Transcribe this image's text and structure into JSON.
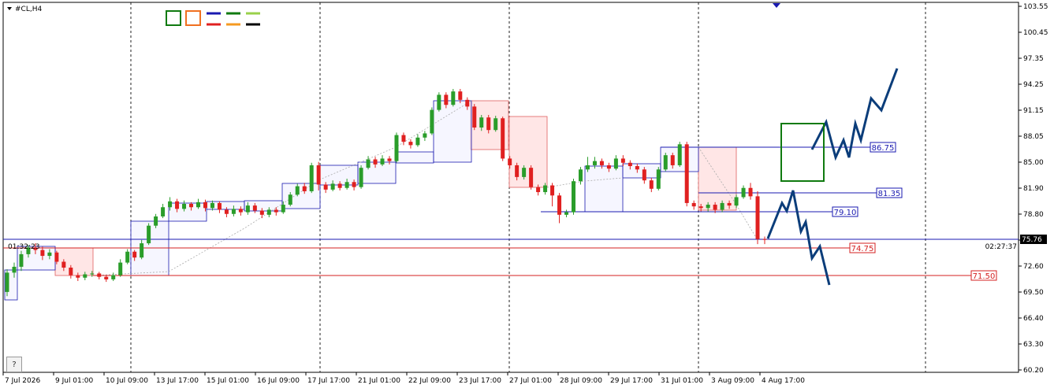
{
  "symbol_label": "#CL,H4",
  "time_left": "01:32:23",
  "time_right": "02:27:37",
  "help_label": "?",
  "legend_icons": [
    "square-green-icon",
    "square-orange-icon",
    "line-blue-icon",
    "line-green-icon",
    "line-lightgreen-icon",
    "line-red-icon",
    "line-orange-icon",
    "line-black-icon"
  ],
  "colors": {
    "bull": "#2a9d2a",
    "bear": "#e02020",
    "level_blue": "#1a1ab0",
    "level_red": "#d42020",
    "forecast": "#0b3d7a",
    "current_price_bg": "#000000",
    "box_green": "#0f7a0f"
  },
  "price_axis": [
    "103.55",
    "100.45",
    "97.35",
    "94.25",
    "91.15",
    "88.05",
    "85.00",
    "81.90",
    "78.80",
    "75.70",
    "72.60",
    "69.50",
    "66.40",
    "63.30",
    "60.20"
  ],
  "time_axis": [
    "7 Jul 2026",
    "9 Jul 01:00",
    "10 Jul 09:00",
    "13 Jul 17:00",
    "15 Jul 01:00",
    "16 Jul 09:00",
    "17 Jul 17:00",
    "21 Jul 01:00",
    "22 Jul 09:00",
    "23 Jul 17:00",
    "27 Jul 01:00",
    "28 Jul 09:00",
    "29 Jul 17:00",
    "31 Jul 01:00",
    "3 Aug 09:00",
    "4 Aug 17:00"
  ],
  "levels": {
    "l8675": "86.75",
    "l8135": "81.35",
    "l7910": "79.10",
    "l7475": "74.75",
    "l7150": "71.50",
    "current": "75.76"
  },
  "chart_data": {
    "type": "candlestick",
    "symbol": "#CL",
    "timeframe": "H4",
    "ylim": [
      60.2,
      103.55
    ],
    "current_price": 75.76,
    "levels": [
      86.75,
      81.35,
      79.1,
      74.75,
      71.5
    ],
    "candles": [
      [
        69.5,
        71.8,
        69.0,
        72.2
      ],
      [
        71.8,
        72.5,
        71.2,
        73.0
      ],
      [
        72.5,
        74.0,
        72.0,
        74.4
      ],
      [
        74.0,
        74.8,
        73.6,
        75.1
      ],
      [
        74.8,
        74.5,
        74.0,
        75.3
      ],
      [
        74.5,
        73.8,
        73.3,
        74.9
      ],
      [
        73.8,
        74.2,
        73.4,
        74.6
      ],
      [
        74.2,
        73.1,
        72.8,
        74.4
      ],
      [
        73.1,
        72.4,
        72.0,
        73.4
      ],
      [
        72.4,
        71.5,
        71.1,
        72.7
      ],
      [
        71.5,
        71.2,
        70.8,
        71.8
      ],
      [
        71.2,
        71.6,
        70.9,
        71.9
      ],
      [
        71.6,
        71.7,
        71.3,
        72.0
      ],
      [
        71.7,
        71.3,
        71.0,
        71.9
      ],
      [
        71.3,
        71.0,
        70.7,
        71.5
      ],
      [
        71.0,
        71.5,
        70.8,
        71.8
      ],
      [
        71.5,
        73.0,
        71.3,
        73.4
      ],
      [
        73.0,
        74.3,
        72.8,
        74.6
      ],
      [
        74.3,
        73.6,
        73.2,
        74.5
      ],
      [
        73.6,
        75.3,
        73.4,
        75.7
      ],
      [
        75.3,
        77.4,
        75.1,
        77.7
      ],
      [
        77.4,
        78.5,
        77.1,
        78.8
      ],
      [
        78.5,
        79.6,
        78.3,
        80.0
      ],
      [
        79.6,
        80.3,
        79.2,
        80.8
      ],
      [
        80.3,
        79.4,
        79.0,
        80.6
      ],
      [
        79.4,
        80.0,
        79.1,
        80.4
      ],
      [
        80.0,
        79.6,
        79.2,
        80.2
      ],
      [
        79.6,
        80.2,
        79.4,
        80.6
      ],
      [
        80.2,
        79.5,
        79.1,
        80.5
      ],
      [
        79.5,
        80.1,
        79.2,
        80.4
      ],
      [
        80.1,
        79.3,
        78.9,
        80.3
      ],
      [
        79.3,
        78.8,
        78.4,
        79.6
      ],
      [
        78.8,
        79.4,
        78.5,
        79.8
      ],
      [
        79.4,
        79.0,
        78.6,
        79.7
      ],
      [
        79.0,
        79.8,
        78.7,
        80.2
      ],
      [
        79.8,
        79.2,
        78.9,
        80.1
      ],
      [
        79.2,
        78.7,
        78.3,
        79.5
      ],
      [
        78.7,
        79.3,
        78.4,
        79.6
      ],
      [
        79.3,
        79.0,
        78.6,
        79.6
      ],
      [
        79.0,
        79.9,
        78.8,
        80.3
      ],
      [
        79.9,
        81.1,
        79.7,
        81.4
      ],
      [
        81.1,
        82.1,
        80.9,
        82.4
      ],
      [
        82.1,
        81.5,
        81.2,
        82.5
      ],
      [
        81.5,
        84.6,
        81.3,
        84.9
      ],
      [
        84.6,
        82.3,
        81.6,
        85.0
      ],
      [
        82.3,
        81.7,
        81.3,
        82.6
      ],
      [
        81.7,
        82.4,
        81.5,
        82.8
      ],
      [
        82.4,
        81.9,
        81.6,
        82.7
      ],
      [
        81.9,
        82.6,
        81.7,
        83.0
      ],
      [
        82.6,
        82.0,
        81.6,
        82.9
      ],
      [
        82.0,
        84.3,
        81.8,
        84.6
      ],
      [
        84.3,
        85.3,
        84.1,
        85.7
      ],
      [
        85.3,
        84.7,
        84.3,
        85.6
      ],
      [
        84.7,
        85.4,
        84.5,
        85.8
      ],
      [
        85.4,
        85.1,
        84.7,
        85.7
      ],
      [
        85.1,
        88.2,
        84.9,
        88.5
      ],
      [
        88.2,
        87.4,
        87.0,
        88.5
      ],
      [
        87.4,
        87.0,
        86.6,
        87.7
      ],
      [
        87.0,
        87.9,
        86.8,
        88.3
      ],
      [
        87.9,
        88.4,
        87.5,
        88.7
      ],
      [
        88.4,
        91.2,
        88.2,
        91.5
      ],
      [
        91.2,
        93.0,
        91.0,
        93.3
      ],
      [
        93.0,
        91.8,
        91.4,
        93.3
      ],
      [
        91.8,
        93.4,
        91.6,
        93.7
      ],
      [
        93.4,
        92.4,
        92.0,
        93.7
      ],
      [
        92.4,
        91.6,
        91.2,
        92.7
      ],
      [
        91.6,
        89.1,
        88.8,
        91.9
      ],
      [
        89.1,
        90.3,
        88.7,
        90.6
      ],
      [
        90.3,
        88.8,
        88.4,
        90.6
      ],
      [
        88.8,
        90.2,
        88.6,
        90.5
      ],
      [
        90.2,
        85.4,
        85.1,
        90.4
      ],
      [
        85.4,
        84.6,
        84.2,
        85.7
      ],
      [
        84.6,
        83.2,
        82.8,
        84.9
      ],
      [
        83.2,
        84.3,
        82.9,
        84.6
      ],
      [
        84.3,
        82.0,
        81.7,
        84.6
      ],
      [
        82.0,
        81.4,
        81.0,
        82.3
      ],
      [
        81.4,
        82.2,
        81.1,
        82.5
      ],
      [
        82.2,
        81.0,
        79.7,
        82.5
      ],
      [
        81.0,
        78.7,
        77.7,
        81.3
      ],
      [
        78.7,
        79.0,
        78.4,
        79.3
      ],
      [
        79.0,
        82.7,
        78.7,
        83.0
      ],
      [
        82.7,
        84.1,
        82.3,
        84.4
      ],
      [
        84.1,
        84.6,
        83.8,
        85.6
      ],
      [
        84.6,
        85.1,
        84.2,
        85.6
      ],
      [
        85.1,
        84.6,
        84.2,
        85.4
      ],
      [
        84.6,
        84.2,
        83.8,
        84.9
      ],
      [
        84.2,
        85.4,
        84.0,
        85.8
      ],
      [
        85.4,
        84.9,
        84.5,
        85.8
      ],
      [
        84.9,
        84.5,
        84.1,
        85.2
      ],
      [
        84.5,
        84.1,
        83.7,
        84.8
      ],
      [
        84.1,
        82.8,
        82.4,
        84.4
      ],
      [
        82.8,
        81.8,
        81.4,
        83.1
      ],
      [
        81.8,
        84.1,
        81.6,
        84.4
      ],
      [
        84.1,
        85.8,
        83.9,
        86.1
      ],
      [
        85.8,
        84.6,
        84.2,
        86.1
      ],
      [
        84.6,
        87.1,
        84.4,
        87.4
      ],
      [
        87.1,
        80.1,
        79.7,
        87.4
      ],
      [
        80.1,
        79.7,
        79.3,
        80.4
      ],
      [
        79.7,
        79.5,
        79.1,
        80.0
      ],
      [
        79.5,
        79.9,
        79.1,
        80.2
      ],
      [
        79.9,
        79.3,
        78.9,
        80.2
      ],
      [
        79.3,
        80.1,
        79.0,
        80.4
      ],
      [
        80.1,
        79.8,
        79.4,
        80.4
      ],
      [
        79.8,
        80.8,
        79.5,
        81.1
      ],
      [
        80.8,
        81.9,
        80.6,
        82.2
      ],
      [
        81.9,
        80.9,
        80.5,
        82.5
      ],
      [
        80.9,
        75.8,
        75.2,
        81.5
      ],
      [
        75.8,
        75.76,
        75.2,
        76.1
      ]
    ]
  }
}
